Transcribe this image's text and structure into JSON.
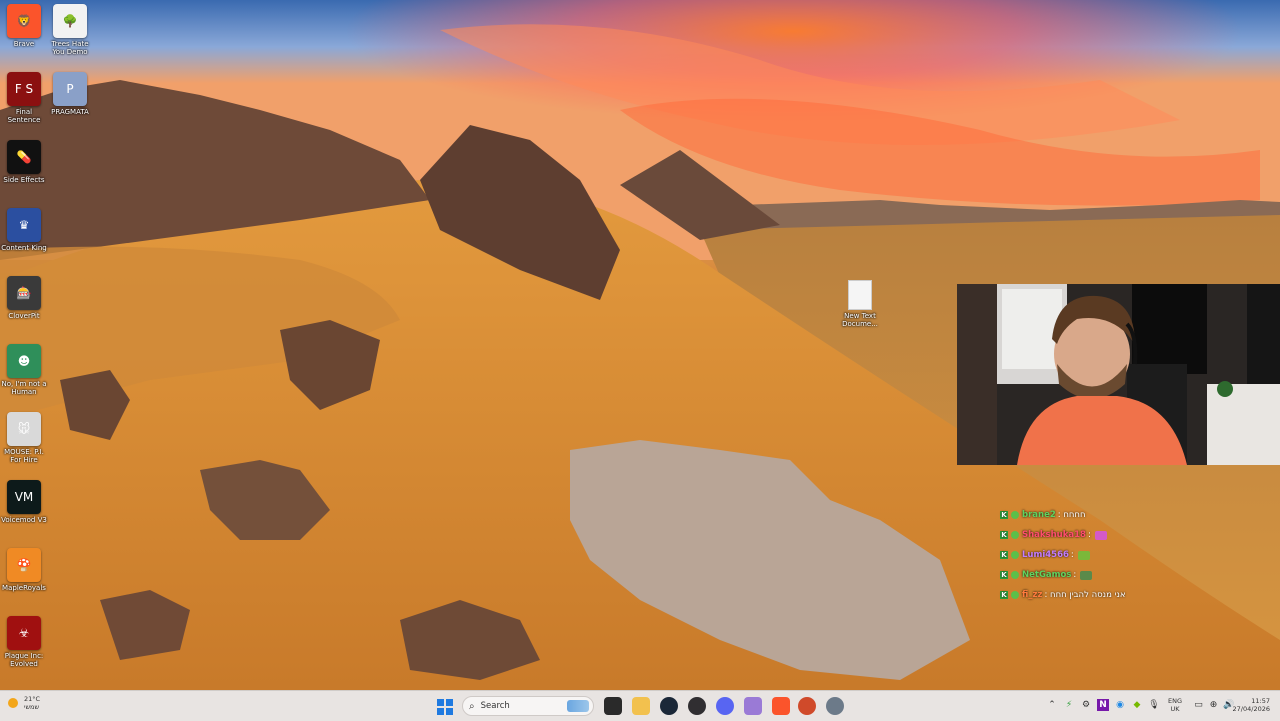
{
  "desktop": {
    "icons": [
      {
        "label": "Brave",
        "icon": "brave-lion-icon",
        "color": "#fb542b",
        "glyph": "🦁"
      },
      {
        "label": "Trees Hate You Demo",
        "icon": "tree-icon",
        "color": "#f2f2f2",
        "glyph": "🌳"
      },
      {
        "label": "Final Sentence",
        "icon": "fs-logo-icon",
        "color": "#8b1010",
        "glyph": "F S"
      },
      {
        "label": "PRAGMATA",
        "icon": "pragmata-icon",
        "color": "#8aa0c8",
        "glyph": "P"
      },
      {
        "label": "Side Effects",
        "icon": "pill-icon",
        "color": "#111111",
        "glyph": "💊"
      },
      {
        "label": "Content King",
        "icon": "crown-icon",
        "color": "#2b4fa0",
        "glyph": "♛"
      },
      {
        "label": "CloverPit",
        "icon": "slot-machine-icon",
        "color": "#3a3a3a",
        "glyph": "🎰"
      },
      {
        "label": "No, I'm not a Human",
        "icon": "face-icon",
        "color": "#2f8f5a",
        "glyph": "☻"
      },
      {
        "label": "MOUSE: P.I. For Hire",
        "icon": "mouse-icon",
        "color": "#d9d9d9",
        "glyph": "🐭"
      },
      {
        "label": "Voicemod V3",
        "icon": "voicemod-icon",
        "color": "#0d1a1a",
        "glyph": "VM"
      },
      {
        "label": "MapleRoyals",
        "icon": "mushroom-icon",
        "color": "#f08a24",
        "glyph": "🍄"
      },
      {
        "label": "Plague Inc: Evolved",
        "icon": "biohazard-icon",
        "color": "#a01010",
        "glyph": "☣"
      }
    ],
    "file": {
      "label": "New Text Docume...",
      "icon": "text-document-icon"
    }
  },
  "chat": {
    "messages": [
      {
        "badge": "K",
        "user": "brane2",
        "user_color": "#5fd35f",
        "text": ": חחחח"
      },
      {
        "badge": "K",
        "user": "Shakshuka18",
        "user_color": "#ff4d6d",
        "text": ":"
      },
      {
        "badge": "K",
        "user": "Lumi4566",
        "user_color": "#c27cff",
        "text": ":"
      },
      {
        "badge": "K",
        "user": "NetGamos",
        "user_color": "#5fd35f",
        "text": ":"
      },
      {
        "badge": "K",
        "user": "fi_zz",
        "user_color": "#ff7a3d",
        "text": ": אני מנסה להבין חחח"
      }
    ]
  },
  "taskbar": {
    "weather": {
      "temp": "21°C",
      "condition": "שמשי",
      "icon": "sun-icon"
    },
    "search_placeholder": "Search",
    "apps": [
      "file-explorer-icon",
      "folder-icon",
      "steam-icon",
      "obs-icon",
      "discord-icon",
      "vs-icon",
      "brave-icon",
      "app-icon",
      "settings-icon"
    ],
    "lang": {
      "line1": "ENG",
      "line2": "UK"
    },
    "clock": {
      "time": "11:57",
      "date": "27/04/2026"
    }
  },
  "colors": {
    "taskbar_bg": "#e8e4e2",
    "accent": "#1f7ae0"
  }
}
